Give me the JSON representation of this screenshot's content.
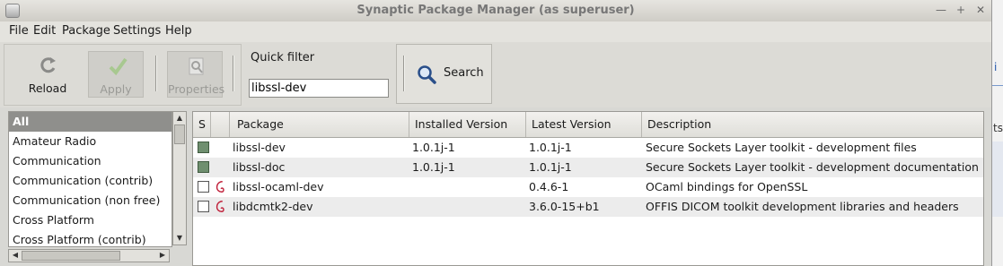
{
  "window": {
    "title": "Synaptic Package Manager  (as superuser)"
  },
  "menu": [
    "File",
    "Edit",
    "Package",
    "Settings",
    "Help"
  ],
  "toolbar": {
    "reload": "Reload",
    "apply": "Apply",
    "properties": "Properties",
    "quick_filter_label": "Quick filter",
    "quick_filter_value": "libssl-dev",
    "search": "Search"
  },
  "sections": [
    "All",
    "Amateur Radio",
    "Communication",
    "Communication (contrib)",
    "Communication (non free)",
    "Cross Platform",
    "Cross Platform (contrib)"
  ],
  "table": {
    "headers": [
      "S",
      "Package",
      "Installed Version",
      "Latest Version",
      "Description"
    ],
    "rows": [
      {
        "installed_status": true,
        "debian_icon": false,
        "package": "libssl-dev",
        "installed_version": "1.0.1j-1",
        "latest_version": "1.0.1j-1",
        "description": "Secure Sockets Layer toolkit - development files"
      },
      {
        "installed_status": true,
        "debian_icon": false,
        "package": "libssl-doc",
        "installed_version": "1.0.1j-1",
        "latest_version": "1.0.1j-1",
        "description": "Secure Sockets Layer toolkit - development documentation"
      },
      {
        "installed_status": false,
        "debian_icon": true,
        "package": "libssl-ocaml-dev",
        "installed_version": "",
        "latest_version": "0.4.6-1",
        "description": "OCaml bindings for OpenSSL"
      },
      {
        "installed_status": false,
        "debian_icon": true,
        "package": "libdcmtk2-dev",
        "installed_version": "",
        "latest_version": "3.6.0-15+b1",
        "description": "OFFIS DICOM toolkit development libraries and headers"
      }
    ]
  },
  "sliver": {
    "text_a": "i",
    "text_b": "ts"
  },
  "colors": {
    "installed": "#6f8f6f",
    "debian": "#c0203a",
    "selection": "#8f8f8c"
  }
}
